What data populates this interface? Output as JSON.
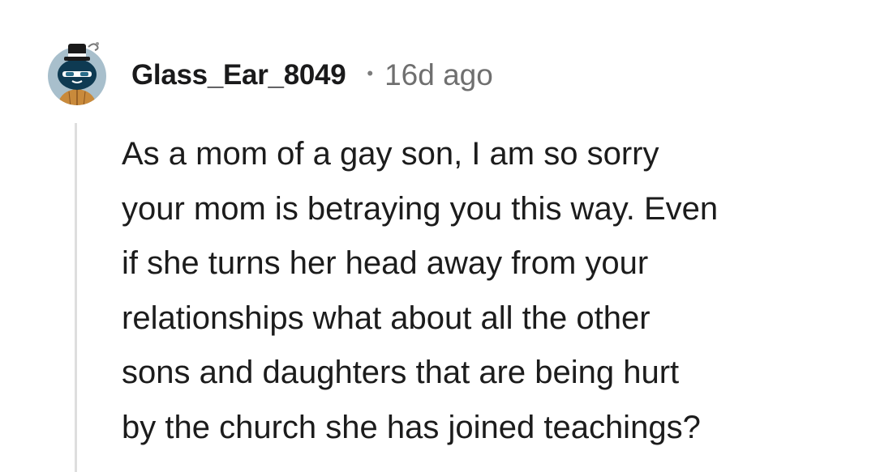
{
  "comment": {
    "author": "Glass_Ear_8049",
    "separator": "•",
    "timestamp": "16d ago",
    "avatar_icon": "snoo-avatar-icon",
    "body_lines": [
      "As a mom of a gay son, I am so sorry",
      "your mom is betraying you this way. Even",
      "if she turns her head away from your",
      "relationships what about all the other",
      "sons and daughters that are being hurt",
      "by the church she has joined teachings?"
    ]
  },
  "colors": {
    "avatar_background": "#a8bfcc",
    "avatar_body": "#0e3a52",
    "hat": "#1a1a1a",
    "thread_line": "#dedede",
    "timestamp_text": "#6f6f6f"
  }
}
